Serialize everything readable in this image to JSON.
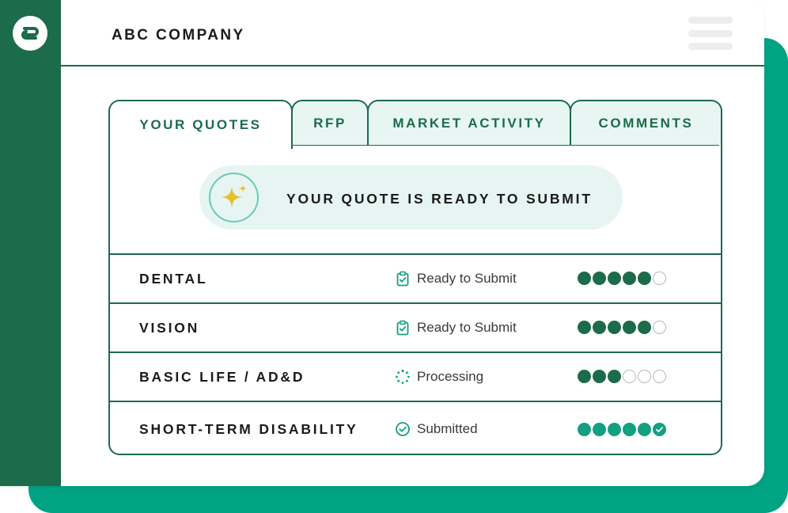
{
  "app": {
    "company_name": "ABC COMPANY",
    "logo_icon": "brand-logo-icon",
    "menu_icon": "hamburger-menu-icon"
  },
  "tabs": [
    {
      "label": "YOUR QUOTES",
      "active": true
    },
    {
      "label": "RFP",
      "active": false
    },
    {
      "label": "MARKET ACTIVITY",
      "active": false
    },
    {
      "label": "COMMENTS",
      "active": false
    }
  ],
  "banner": {
    "icon": "sparkle-icon",
    "text": "YOUR QUOTE IS READY TO SUBMIT"
  },
  "quotes": [
    {
      "name": "DENTAL",
      "status": "Ready to Submit",
      "status_icon": "clipboard-check-icon",
      "progress_filled": 5,
      "progress_total": 6
    },
    {
      "name": "VISION",
      "status": "Ready to Submit",
      "status_icon": "clipboard-check-icon",
      "progress_filled": 5,
      "progress_total": 6
    },
    {
      "name": "BASIC LIFE / AD&D",
      "status": "Processing",
      "status_icon": "spinner-icon",
      "progress_filled": 3,
      "progress_total": 6
    },
    {
      "name": "SHORT-TERM DISABILITY",
      "status": "Submitted",
      "status_icon": "check-circle-icon",
      "progress_filled": 6,
      "progress_total": 6
    }
  ],
  "colors": {
    "brand_dark_green": "#1c6b4a",
    "accent_teal": "#00a383",
    "light_teal_bg": "#e6f5f2",
    "sparkle_gold": "#e6c02f"
  }
}
